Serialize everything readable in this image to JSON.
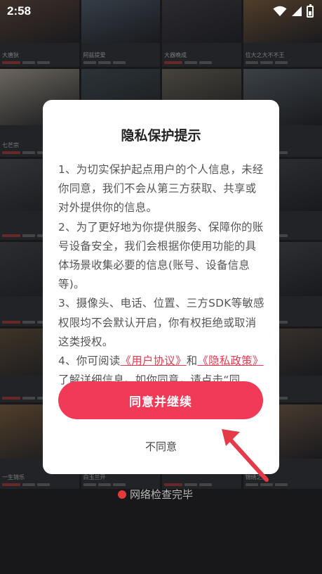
{
  "status_bar": {
    "time": "2:58"
  },
  "background": {
    "cards": [
      {
        "title": "大唐狄",
        "color": "#6a5246"
      },
      {
        "title": "阿兹提爱",
        "color": "#5a6a7a"
      },
      {
        "title": "大器晚成",
        "color": "#4a4a52"
      },
      {
        "title": "位大之大不不王",
        "color": "#8a6a48"
      },
      {
        "title": "七芒宗",
        "color": "#b7b0a2"
      },
      {
        "title": "",
        "color": "#4c5a60"
      },
      {
        "title": "清晨",
        "color": "#7a7566"
      },
      {
        "title": "",
        "color": "#667078"
      },
      {
        "title": "",
        "color": "#55585e"
      },
      {
        "title": "",
        "color": "#4a4e56"
      },
      {
        "title": "",
        "color": "#5e5a54"
      },
      {
        "title": "",
        "color": "#50545c"
      },
      {
        "title": "",
        "color": "#4b4d55"
      },
      {
        "title": "",
        "color": "#52565e"
      },
      {
        "title": "",
        "color": "#4e5259"
      },
      {
        "title": "",
        "color": "#54585f"
      },
      {
        "title": "",
        "color": "#6b5a44"
      },
      {
        "title": "",
        "color": "#5a4a40"
      },
      {
        "title": "",
        "color": "#585a5e"
      },
      {
        "title": "",
        "color": "#6a5c50"
      },
      {
        "title": "一生锦乐",
        "color": "#8a6b4a"
      },
      {
        "title": "白玉兰开",
        "color": "#4a5868"
      },
      {
        "title": "",
        "color": "#5a5048"
      },
      {
        "title": "锦绣之上",
        "color": "#8c7058"
      }
    ],
    "watermark": "网络检查完毕"
  },
  "dialog": {
    "title": "隐私保护提示",
    "paragraph1": "1、为切实保护起点用户的个人信息，未经你同意，我们不会从第三方获取、共享或对外提供你的信息。",
    "paragraph2": "2、为了更好地为你提供服务、保障你的账号设备安全，我们会根据你使用功能的具体场景收集必要的信息(账号、设备信息等)。",
    "paragraph3": "3、摄像头、电话、位置、三方SDK等敏感权限均不会默认开启，你有权拒绝或取消这类授权。",
    "paragraph4_prefix": "4、你可阅读",
    "user_agreement_link": "《用户协议》",
    "and": "和",
    "privacy_policy_link": "《隐私政策》",
    "paragraph4_suffix": "了解详细信息。如你同意，请点击“同意”开始接受我们的服务。",
    "agree_button": "同意并继续",
    "disagree_button": "不同意"
  },
  "colors": {
    "accent": "#f13a57",
    "link": "#e8394f",
    "arrow": "#e53b48"
  }
}
